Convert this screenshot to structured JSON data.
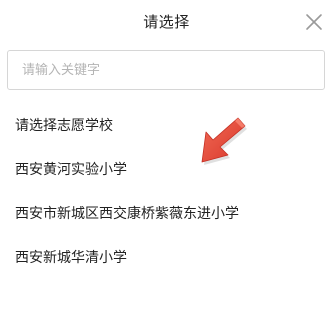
{
  "dialog": {
    "title": "请选择",
    "close_icon": "close-icon"
  },
  "search": {
    "placeholder": "请输入关键字",
    "value": ""
  },
  "options": [
    {
      "label": "请选择志愿学校"
    },
    {
      "label": "西安黄河实验小学"
    },
    {
      "label": "西安市新城区西交康桥紫薇东进小学"
    },
    {
      "label": "西安新城华清小学"
    }
  ],
  "annotation": {
    "icon": "pointer-arrow-icon",
    "color": "#e84c3d"
  }
}
